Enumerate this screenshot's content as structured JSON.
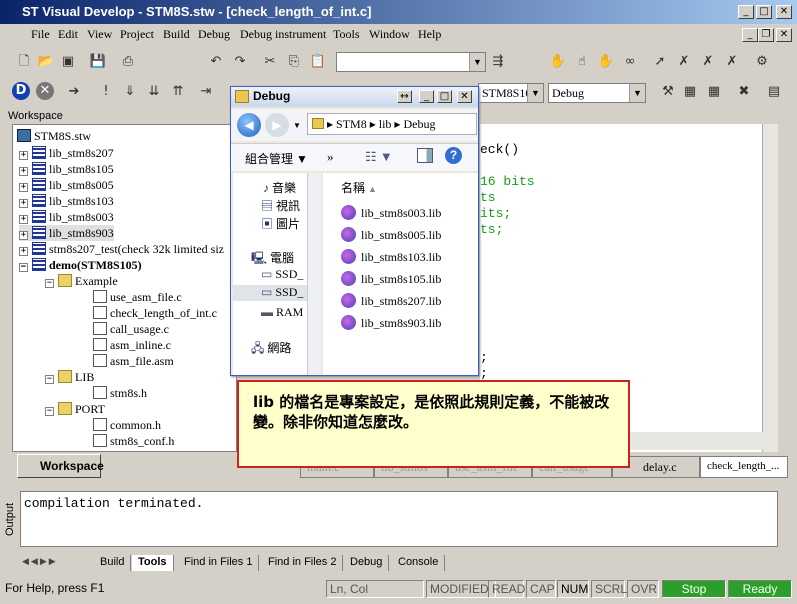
{
  "window": {
    "title": "ST Visual Develop - STM8S.stw - [check_length_of_int.c]",
    "buttons": [
      "_",
      "□",
      "✕"
    ]
  },
  "menu": [
    {
      "label": "File"
    },
    {
      "label": "Edit"
    },
    {
      "label": "View"
    },
    {
      "label": "Project"
    },
    {
      "label": "Build"
    },
    {
      "label": "Debug"
    },
    {
      "label": "Debug instrument"
    },
    {
      "label": "Tools"
    },
    {
      "label": "Window"
    },
    {
      "label": "Help"
    }
  ],
  "toolbar": {
    "find_combo": "",
    "target_combo": "STM8S10",
    "config_combo": "Debug"
  },
  "workspace": {
    "label": "Workspace",
    "tab_label": "Workspace",
    "tree": [
      {
        "label": "STM8S.stw",
        "kind": "ws"
      },
      {
        "label": "lib_stm8s207",
        "kind": "lib"
      },
      {
        "label": "lib_stm8s105",
        "kind": "lib"
      },
      {
        "label": "lib_stm8s005",
        "kind": "lib"
      },
      {
        "label": "lib_stm8s103",
        "kind": "lib"
      },
      {
        "label": "lib_stm8s003",
        "kind": "lib"
      },
      {
        "label": "lib_stm8s903",
        "kind": "lib"
      },
      {
        "label": "stm8s207_test(check 32k limited siz",
        "kind": "lib"
      },
      {
        "label": "demo(STM8S105)",
        "kind": "lib"
      },
      {
        "label": "Example",
        "kind": "folder"
      },
      {
        "label": "use_asm_file.c",
        "kind": "file"
      },
      {
        "label": "check_length_of_int.c",
        "kind": "file"
      },
      {
        "label": "call_usage.c",
        "kind": "file"
      },
      {
        "label": "asm_inline.c",
        "kind": "file"
      },
      {
        "label": "asm_file.asm",
        "kind": "file"
      },
      {
        "label": "LIB",
        "kind": "folder"
      },
      {
        "label": "stm8s.h",
        "kind": "file"
      },
      {
        "label": "PORT",
        "kind": "folder"
      },
      {
        "label": "common.h",
        "kind": "file"
      },
      {
        "label": "stm8s_conf.h",
        "kind": "file"
      }
    ]
  },
  "editor": {
    "lines": [
      "eck()",
      "16 bits",
      "ts",
      "its;",
      "ts;",
      ";",
      ";"
    ],
    "tabs": [
      "main.c",
      "lib_stm8s",
      "use_asm_file",
      "call_usage",
      "delay.c",
      "check_length_..."
    ]
  },
  "output": {
    "label": "Output",
    "text": "compilation terminated.",
    "tabs": [
      "Build",
      "Tools",
      "Find in Files 1",
      "Find in Files 2",
      "Debug",
      "Console"
    ]
  },
  "statusbar": {
    "help": "For Help, press F1",
    "lncol": "Ln, Col",
    "modified": "MODIFIED",
    "read": "READ",
    "cap": "CAP",
    "num": "NUM",
    "scrl": "SCRL",
    "ovr": "OVR",
    "stop": "Stop",
    "ready": "Ready"
  },
  "dialog": {
    "title": "Debug",
    "path": [
      "STM8",
      "lib",
      "Debug"
    ],
    "organize": "組合管理",
    "more": "»",
    "column_header": "名稱",
    "left_items": [
      "音樂",
      "視訊",
      "圖片",
      "電腦",
      "SSD_",
      "SSD_",
      "RAM",
      "網路"
    ],
    "files": [
      "lib_stm8s003.lib",
      "lib_stm8s005.lib",
      "lib_stm8s103.lib",
      "lib_stm8s105.lib",
      "lib_stm8s207.lib",
      "lib_stm8s903.lib"
    ]
  },
  "callout": {
    "text": "lib 的檔名是專案設定，是依照此規則定義，不能被改變。除非你知道怎麼改。"
  }
}
